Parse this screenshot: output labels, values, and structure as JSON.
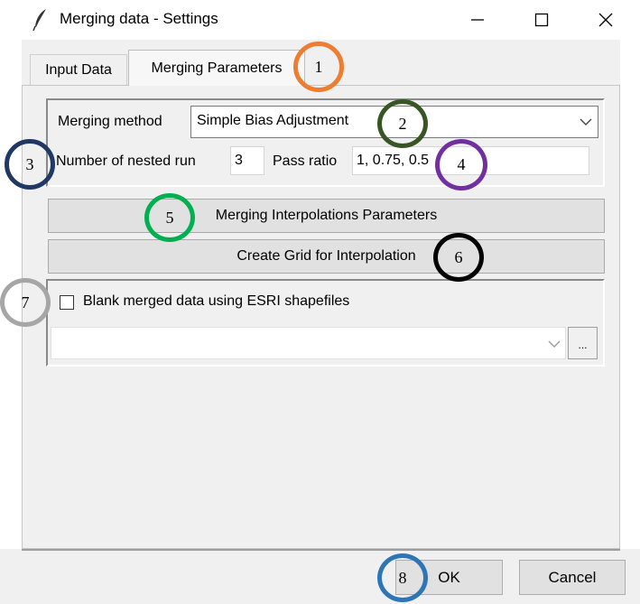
{
  "window": {
    "title": "Merging data - Settings",
    "icon": "feather-icon",
    "controls": [
      "minimize-icon",
      "maximize-icon",
      "close-icon"
    ]
  },
  "tabs": [
    {
      "label": "Input Data",
      "selected": false
    },
    {
      "label": "Merging Parameters",
      "selected": true
    }
  ],
  "merging": {
    "method_label": "Merging method",
    "method_value": "Simple Bias Adjustment",
    "nested_label": "Number of nested run",
    "nested_value": "3",
    "pass_label": "Pass ratio",
    "pass_value": "1, 0.75, 0.5"
  },
  "buttons": {
    "interp_params": "Merging Interpolations Parameters",
    "create_grid": "Create Grid for Interpolation",
    "browse": "...",
    "ok": "OK",
    "cancel": "Cancel"
  },
  "blank": {
    "checkbox_label": "Blank merged data using ESRI shapefiles",
    "checked": false,
    "shapefile_value": ""
  },
  "annotations": [
    {
      "label": "1",
      "color": "#ed7d31"
    },
    {
      "label": "2",
      "color": "#375623"
    },
    {
      "label": "3",
      "color": "#1f3864"
    },
    {
      "label": "4",
      "color": "#7030a0"
    },
    {
      "label": "5",
      "color": "#00b050"
    },
    {
      "label": "6",
      "color": "#000000"
    },
    {
      "label": "7",
      "color": "#a6a6a6"
    },
    {
      "label": "8",
      "color": "#2e75b6"
    }
  ]
}
